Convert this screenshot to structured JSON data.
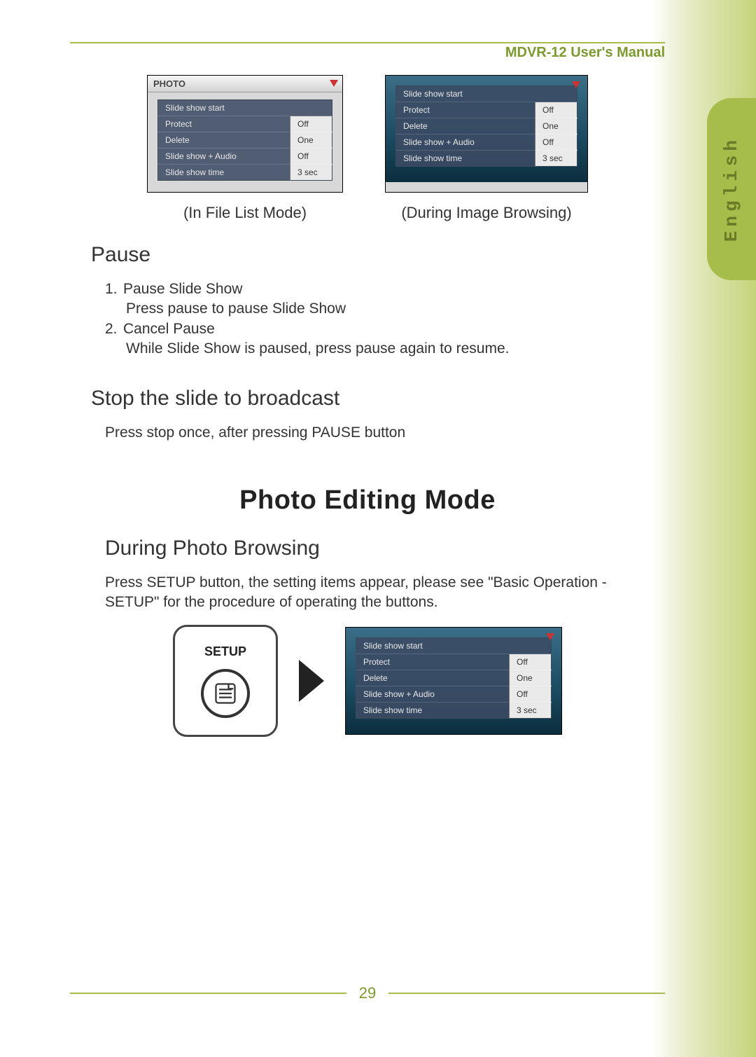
{
  "header": {
    "manual_title": "MDVR-12 User's Manual"
  },
  "language_tab": "English",
  "screenshots": {
    "left": {
      "titlebar": "PHOTO",
      "menu": [
        {
          "label": "Slide show start",
          "value": ""
        },
        {
          "label": "Protect",
          "value": "Off"
        },
        {
          "label": "Delete",
          "value": "One"
        },
        {
          "label": "Slide show + Audio",
          "value": "Off"
        },
        {
          "label": "Slide show time",
          "value": "3 sec"
        }
      ]
    },
    "right": {
      "menu": [
        {
          "label": "Slide show start",
          "value": ""
        },
        {
          "label": "Protect",
          "value": "Off"
        },
        {
          "label": "Delete",
          "value": "One"
        },
        {
          "label": "Slide show + Audio",
          "value": "Off"
        },
        {
          "label": "Slide show time",
          "value": "3 sec"
        }
      ]
    }
  },
  "captions": {
    "left": "(In File List Mode)",
    "right": "(During Image Browsing)"
  },
  "pause": {
    "heading": "Pause",
    "item1_num": "1.",
    "item1_title": "Pause Slide Show",
    "item1_body": "Press pause to pause Slide Show",
    "item2_num": "2.",
    "item2_title": "Cancel Pause",
    "item2_body": "While Slide Show is paused, press pause again to resume."
  },
  "stop": {
    "heading": "Stop the slide to broadcast",
    "body": "Press stop once, after pressing PAUSE button"
  },
  "photo_editing": {
    "title": "Photo Editing Mode",
    "subheading": "During Photo Browsing",
    "body": "Press SETUP button, the setting items appear, please see \"Basic Operation - SETUP\" for the procedure of operating the buttons."
  },
  "setup": {
    "label": "SETUP",
    "menu": [
      {
        "label": "Slide show start",
        "value": ""
      },
      {
        "label": "Protect",
        "value": "Off"
      },
      {
        "label": "Delete",
        "value": "One"
      },
      {
        "label": "Slide show + Audio",
        "value": "Off"
      },
      {
        "label": "Slide show time",
        "value": "3 sec"
      }
    ]
  },
  "page_number": "29"
}
